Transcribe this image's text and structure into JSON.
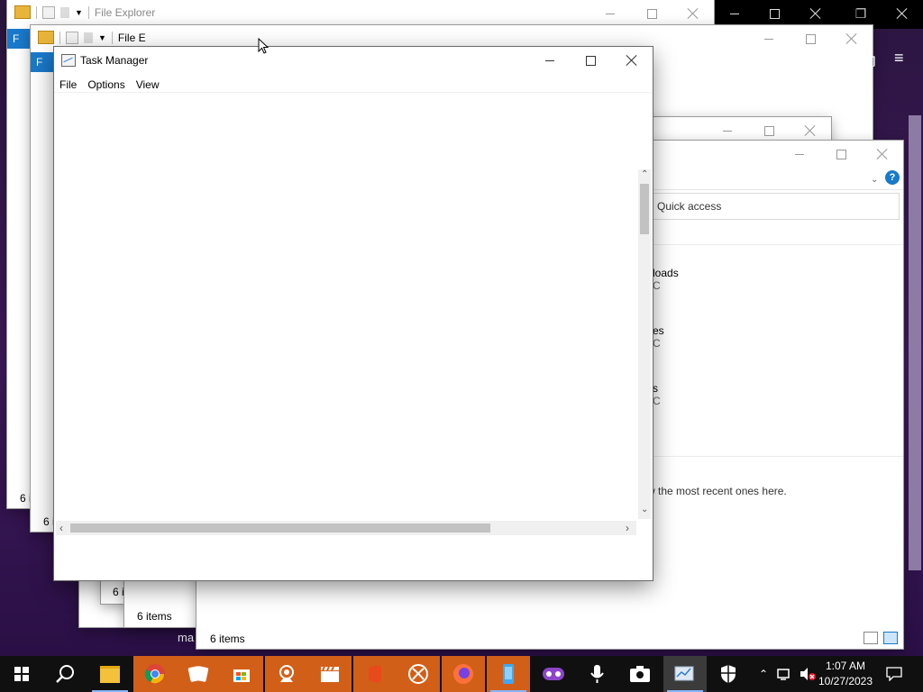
{
  "colors": {
    "accent": "#1979ca",
    "taskbar": "#101010",
    "desktop": "#3d1a5a"
  },
  "background_windows": {
    "explorer_1": {
      "title": "File Explorer",
      "ribbon_tab": "F",
      "status": "6 i"
    },
    "explorer_2": {
      "title": "File E",
      "ribbon_tab": "F",
      "status": "6 i"
    },
    "explorer_3": {
      "status": "6 i"
    },
    "explorer_4": {
      "status": "6 items"
    },
    "explorer_main": {
      "address": "Quick access",
      "items": [
        {
          "name": "loads",
          "sub": "C"
        },
        {
          "name": "es",
          "sub": "C"
        },
        {
          "name": "s",
          "sub": "C"
        }
      ],
      "recent_hint": "w the most recent ones here.",
      "status": "6 items",
      "partial_label": "ma"
    }
  },
  "task_manager": {
    "title": "Task Manager",
    "menu": [
      "File",
      "Options",
      "View"
    ]
  },
  "taskbar": {
    "apps": [
      "start-icon",
      "search-icon",
      "file-explorer-icon",
      "chrome-icon",
      "solitaire-icon",
      "store-icon",
      "webcam-icon",
      "clapper-icon",
      "office-icon",
      "xbox-icon",
      "firefox-icon",
      "phone-icon",
      "mixed-reality-icon",
      "voice-recorder-icon",
      "camera-icon",
      "task-manager-icon",
      "security-icon"
    ],
    "time": "1:07 AM",
    "date": "10/27/2023"
  }
}
